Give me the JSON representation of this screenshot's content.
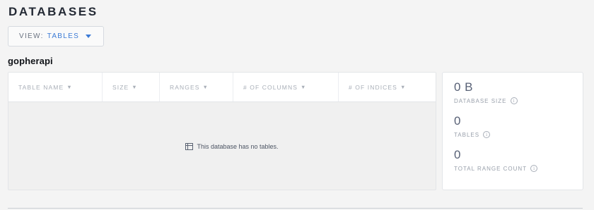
{
  "page": {
    "title": "DATABASES"
  },
  "view_selector": {
    "prefix": "VIEW:",
    "value": "TABLES",
    "caret_icon": "chevron-down-icon"
  },
  "database": {
    "name": "gopherapi"
  },
  "table": {
    "columns": [
      {
        "label": "TABLE NAME",
        "sort_icon": "▼"
      },
      {
        "label": "SIZE",
        "sort_icon": "▼"
      },
      {
        "label": "RANGES",
        "sort_icon": "▼"
      },
      {
        "label": "# OF COLUMNS",
        "sort_icon": "▼"
      },
      {
        "label": "# OF INDICES",
        "sort_icon": "▼"
      }
    ],
    "empty_message": "This database has no tables.",
    "empty_icon": "table-icon"
  },
  "summary": {
    "database_size": {
      "value": "0 B",
      "label": "DATABASE SIZE"
    },
    "tables": {
      "value": "0",
      "label": "TABLES"
    },
    "total_range_count": {
      "value": "0",
      "label": "TOTAL RANGE COUNT"
    },
    "info_icon": "info-icon",
    "info_glyph": "i"
  },
  "colors": {
    "accent": "#3c7bd6",
    "background": "#f4f4f4",
    "card": "#ffffff",
    "stat_value": "#586176"
  }
}
